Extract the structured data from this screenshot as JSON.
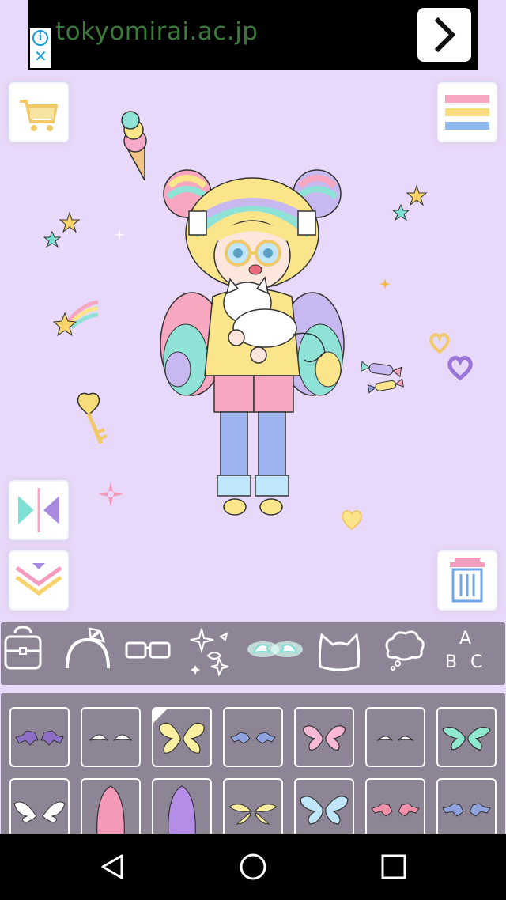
{
  "ad": {
    "url_text": "tokyomirai.ac.jp",
    "info_icon": "info-icon",
    "close_icon": "close-icon",
    "arrow_icon": "chevron-right-icon"
  },
  "toolbar": {
    "shop": "cart-icon",
    "menu": "menu-icon",
    "flip": "flip-icon",
    "collapse": "chevron-down-icon",
    "delete": "trash-icon"
  },
  "categories": [
    {
      "name": "bag",
      "icon": "bag-icon"
    },
    {
      "name": "headband",
      "icon": "headband-icon"
    },
    {
      "name": "glasses",
      "icon": "glasses-icon"
    },
    {
      "name": "sparkles",
      "icon": "sparkles-icon"
    },
    {
      "name": "wings",
      "icon": "wings-icon",
      "selected": true
    },
    {
      "name": "cat-ears",
      "icon": "cat-ears-icon"
    },
    {
      "name": "thought-bubble",
      "icon": "thought-bubble-icon"
    },
    {
      "name": "text",
      "icon": "abc-icon"
    }
  ],
  "abc_label": {
    "a": "A",
    "b": "B",
    "c": "C"
  },
  "items": [
    {
      "name": "purple-bat-wings",
      "color": "#8e6fc8"
    },
    {
      "name": "white-small-wings",
      "color": "#ffffff"
    },
    {
      "name": "yellow-butterfly-wings",
      "color": "#fbf0a0",
      "selected": true
    },
    {
      "name": "blue-bat-wings",
      "color": "#8ea2e0"
    },
    {
      "name": "pink-butterfly-wings",
      "color": "#f9b8d6"
    },
    {
      "name": "white-tiny-wings",
      "color": "#ffffff"
    },
    {
      "name": "mint-butterfly-wings",
      "color": "#8fe8d0"
    },
    {
      "name": "white-angel-wings",
      "color": "#ffffff"
    },
    {
      "name": "pink-cape",
      "color": "#f49ab8"
    },
    {
      "name": "purple-cape",
      "color": "#b38de6"
    },
    {
      "name": "yellow-petal-wings",
      "color": "#fbf0a0"
    },
    {
      "name": "light-blue-butterfly-wings",
      "color": "#bfe6fb"
    },
    {
      "name": "pink-bat-wings",
      "color": "#f08fa8"
    },
    {
      "name": "blue-bat-wings-2",
      "color": "#8ea2e0"
    }
  ],
  "colors": {
    "background": "#e8d9fb",
    "panel": "#8d8596"
  },
  "nav": {
    "back": "back-icon",
    "home": "home-icon",
    "recents": "recents-icon"
  }
}
